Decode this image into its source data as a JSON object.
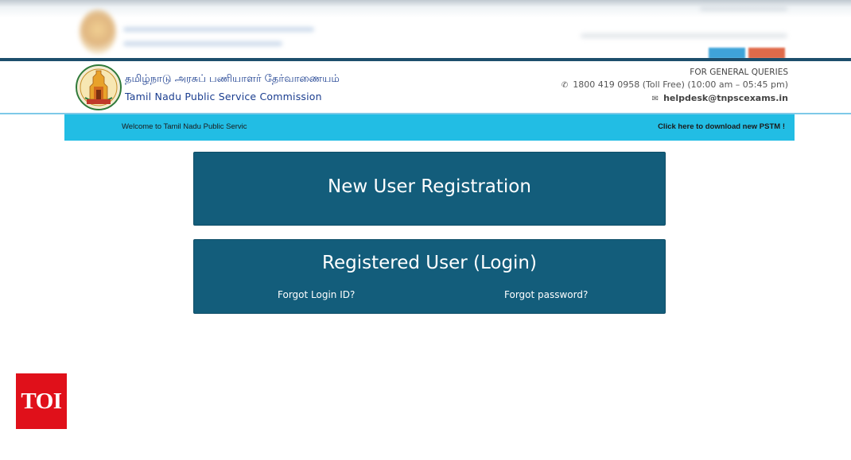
{
  "header": {
    "tamil_title": "தமிழ்நாடு அரசுப் பணியாளர் தேர்வாணையம்",
    "english_title": "Tamil Nadu Public Service Commission",
    "queries_title": "FOR GENERAL QUERIES",
    "phone": "1800 419 0958 (Toll Free)  (10:00 am – 05:45 pm)",
    "email": "helpdesk@tnpscexams.in",
    "phone_icon": "phone-icon",
    "email_icon": "envelope-icon"
  },
  "banner": {
    "welcome_text": "Welcome to Tamil Nadu Public Servic",
    "download_link": "Click here to download new PSTM !"
  },
  "cards": {
    "new_user": "New User Registration",
    "registered_user": "Registered User (Login)",
    "forgot_login_id": "Forgot Login ID?",
    "forgot_password": "Forgot password?"
  },
  "watermark": {
    "label": "TOI"
  },
  "colors": {
    "card_bg": "#135d7b",
    "banner_bg": "#22bde4",
    "header_rule": "#1d4e6c",
    "title_blue": "#1a3d8f",
    "watermark_red": "#e0101a"
  }
}
